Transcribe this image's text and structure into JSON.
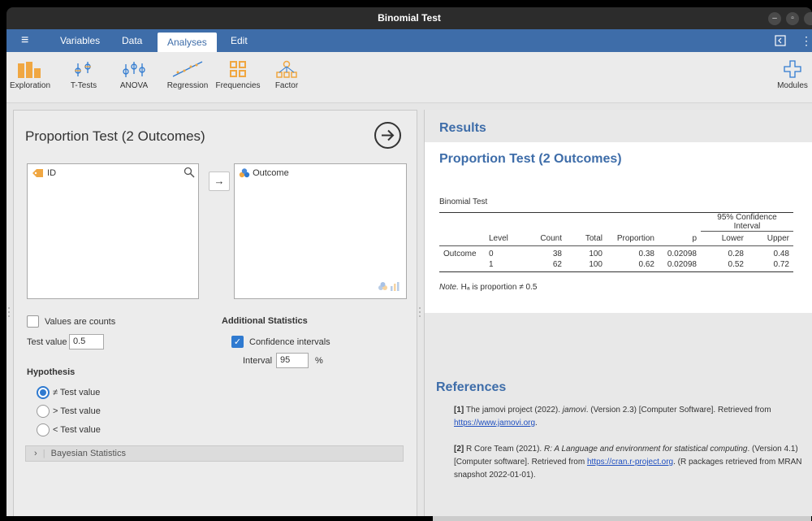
{
  "window": {
    "title": "Binomial Test",
    "minimize_label": "–",
    "restore_label": "▫",
    "close_label": "×"
  },
  "menu": {
    "hamburger": "≡",
    "tabs": [
      "Variables",
      "Data",
      "Analyses",
      "Edit"
    ],
    "active_tab": "Analyses"
  },
  "ribbon": {
    "items": [
      "Exploration",
      "T-Tests",
      "ANOVA",
      "Regression",
      "Frequencies",
      "Factor"
    ],
    "modules": "Modules"
  },
  "colors": {
    "accent": "#3e6da9",
    "ribbon_orange": "#f0a742",
    "check_blue": "#2f7ad0"
  },
  "analysis": {
    "title": "Proportion Test (2 Outcomes)",
    "available_vars": [
      "ID"
    ],
    "selected_vars": [
      "Outcome"
    ],
    "move_arrow": "→",
    "values_are_counts": "Values are counts",
    "test_value_label": "Test value",
    "test_value": "0.5",
    "hypothesis_label": "Hypothesis",
    "hypothesis_options": [
      "≠ Test value",
      "> Test value",
      "< Test value"
    ],
    "selected_hypothesis": "≠ Test value",
    "additional_label": "Additional Statistics",
    "ci_label": "Confidence intervals",
    "ci_checked": true,
    "interval_label": "Interval",
    "interval_value": "95",
    "interval_unit": "%",
    "bayesian_label": "Bayesian Statistics",
    "bayesian_chevron": "›"
  },
  "results": {
    "heading": "Results",
    "analysis_heading": "Proportion Test (2 Outcomes)",
    "table_title": "Binomial Test",
    "ci_header": "95% Confidence Interval",
    "columns": [
      "Level",
      "Count",
      "Total",
      "Proportion",
      "p",
      "Lower",
      "Upper"
    ],
    "row_label": "Outcome",
    "rows": [
      [
        "0",
        "38",
        "100",
        "0.38",
        "0.02098",
        "0.28",
        "0.48"
      ],
      [
        "1",
        "62",
        "100",
        "0.62",
        "0.02098",
        "0.52",
        "0.72"
      ]
    ],
    "note_prefix": "Note.",
    "note_text": " Hₐ is proportion ≠ 0.5"
  },
  "references": {
    "heading": "References",
    "items": [
      {
        "num": "[1]",
        "pre": "The jamovi project (2022). ",
        "italic": "jamovi",
        "post": ". (Version 2.3) [Computer Software]. Retrieved from ",
        "link": "https://www.jamovi.org",
        "tail": "."
      },
      {
        "num": "[2]",
        "pre": "R Core Team (2021). ",
        "italic": "R: A Language and environment for statistical computing",
        "post": ". (Version 4.1) [Computer software]. Retrieved from ",
        "link": "https://cran.r-project.org",
        "tail": ". (R packages retrieved from MRAN snapshot 2022-01-01)."
      }
    ]
  }
}
